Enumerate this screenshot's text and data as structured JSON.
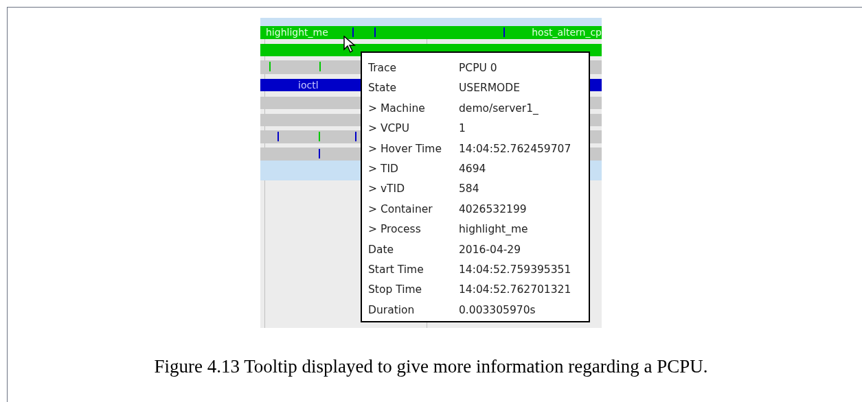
{
  "timeline": {
    "rows": [
      {
        "color": "#c8e0f4"
      },
      {
        "color": "#00c800",
        "labels": [
          "highlight_me",
          "host_altern_cp"
        ]
      },
      {
        "color": "#00c800"
      },
      {
        "color": "#c8c8c8"
      },
      {
        "color": "#0000c8",
        "labels": [
          "ioctl"
        ]
      },
      {
        "color": "#c8c8c8"
      },
      {
        "color": "#c8c8c8"
      },
      {
        "color": "#c8c8c8"
      },
      {
        "color": "#c8c8c8"
      },
      {
        "color": "#c8e0f4"
      }
    ]
  },
  "tooltip": {
    "rows": [
      {
        "label": "Trace",
        "value": "PCPU 0"
      },
      {
        "label": "State",
        "value": "USERMODE"
      },
      {
        "label": "> Machine",
        "value": "demo/server1_"
      },
      {
        "label": "> VCPU",
        "value": "1"
      },
      {
        "label": "> Hover Time",
        "value": "14:04:52.762459707"
      },
      {
        "label": "> TID",
        "value": "4694"
      },
      {
        "label": "> vTID",
        "value": "584"
      },
      {
        "label": "> Container",
        "value": "4026532199"
      },
      {
        "label": "> Process",
        "value": "highlight_me"
      },
      {
        "label": "Date",
        "value": "2016-04-29"
      },
      {
        "label": "Start Time",
        "value": "14:04:52.759395351"
      },
      {
        "label": "Stop Time",
        "value": "14:04:52.762701321"
      },
      {
        "label": "Duration",
        "value": "0.003305970s"
      }
    ]
  },
  "caption": "Figure 4.13 Tooltip displayed to give more information regarding a PCPU."
}
